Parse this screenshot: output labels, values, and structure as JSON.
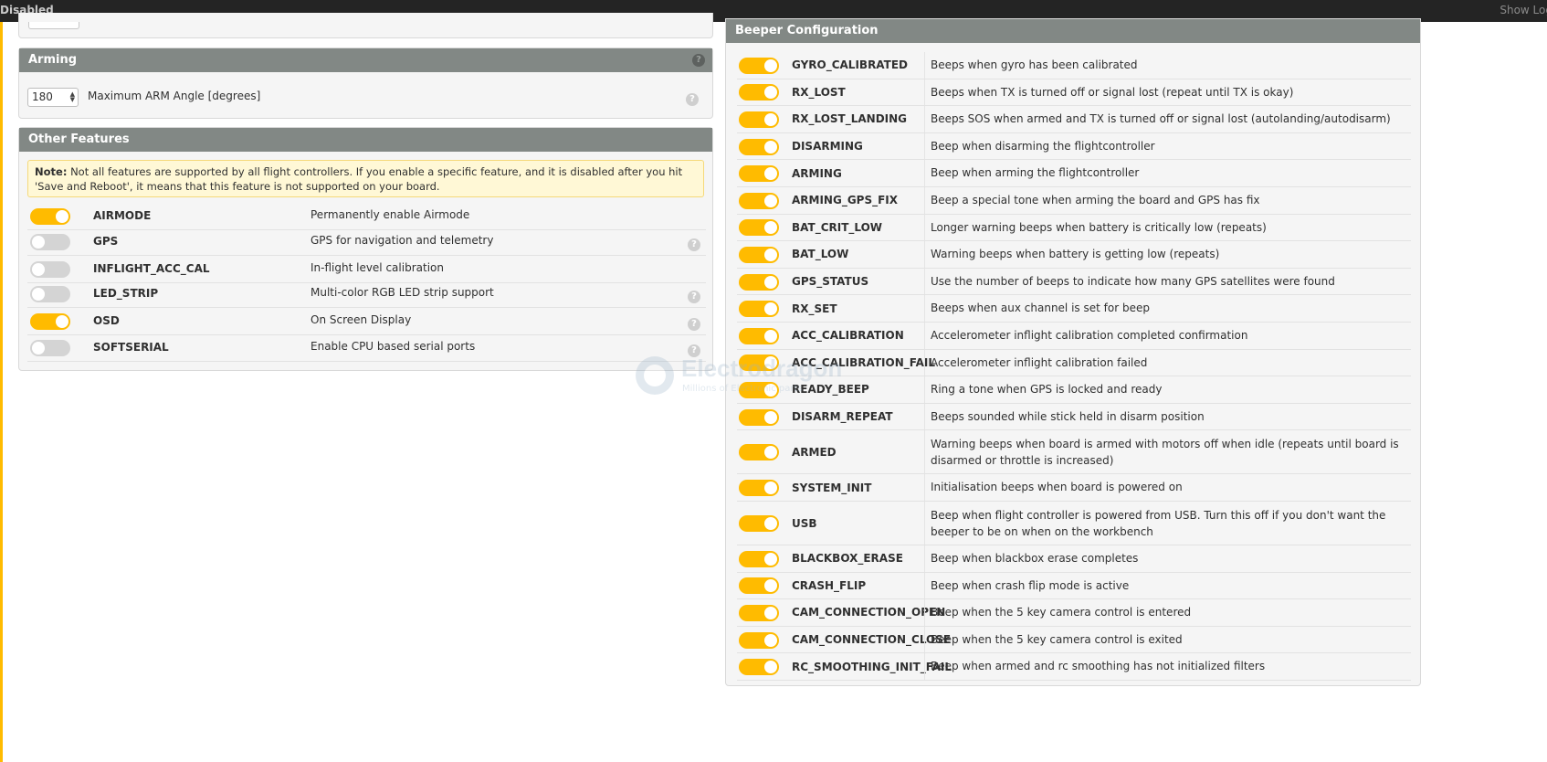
{
  "topbar": {
    "status": "Disabled",
    "show_log": "Show Log"
  },
  "arming": {
    "title": "Arming",
    "help": "?",
    "max_arm_angle_value": "180",
    "max_arm_angle_label": "Maximum ARM Angle [degrees]"
  },
  "other_features": {
    "title": "Other Features",
    "note_label": "Note:",
    "note_text": " Not all features are supported by all flight controllers. If you enable a specific feature, and it is disabled after you hit 'Save and Reboot', it means that this feature is not supported on your board.",
    "help": "?",
    "features": [
      {
        "name": "AIRMODE",
        "desc": "Permanently enable Airmode",
        "enabled": true,
        "help": false
      },
      {
        "name": "GPS",
        "desc": "GPS for navigation and telemetry",
        "enabled": false,
        "help": true
      },
      {
        "name": "INFLIGHT_ACC_CAL",
        "desc": "In-flight level calibration",
        "enabled": false,
        "help": false
      },
      {
        "name": "LED_STRIP",
        "desc": "Multi-color RGB LED strip support",
        "enabled": false,
        "help": true
      },
      {
        "name": "OSD",
        "desc": "On Screen Display",
        "enabled": true,
        "help": true
      },
      {
        "name": "SOFTSERIAL",
        "desc": "Enable CPU based serial ports",
        "enabled": false,
        "help": true
      }
    ]
  },
  "beeper": {
    "title": "Beeper Configuration",
    "items": [
      {
        "name": "GYRO_CALIBRATED",
        "desc": "Beeps when gyro has been calibrated",
        "enabled": true
      },
      {
        "name": "RX_LOST",
        "desc": "Beeps when TX is turned off or signal lost (repeat until TX is okay)",
        "enabled": true
      },
      {
        "name": "RX_LOST_LANDING",
        "desc": "Beeps SOS when armed and TX is turned off or signal lost (autolanding/autodisarm)",
        "enabled": true
      },
      {
        "name": "DISARMING",
        "desc": "Beep when disarming the flightcontroller",
        "enabled": true
      },
      {
        "name": "ARMING",
        "desc": "Beep when arming the flightcontroller",
        "enabled": true
      },
      {
        "name": "ARMING_GPS_FIX",
        "desc": "Beep a special tone when arming the board and GPS has fix",
        "enabled": true
      },
      {
        "name": "BAT_CRIT_LOW",
        "desc": "Longer warning beeps when battery is critically low (repeats)",
        "enabled": true
      },
      {
        "name": "BAT_LOW",
        "desc": "Warning beeps when battery is getting low (repeats)",
        "enabled": true
      },
      {
        "name": "GPS_STATUS",
        "desc": "Use the number of beeps to indicate how many GPS satellites were found",
        "enabled": true
      },
      {
        "name": "RX_SET",
        "desc": "Beeps when aux channel is set for beep",
        "enabled": true
      },
      {
        "name": "ACC_CALIBRATION",
        "desc": "Accelerometer inflight calibration completed confirmation",
        "enabled": true
      },
      {
        "name": "ACC_CALIBRATION_FAIL",
        "desc": "Accelerometer inflight calibration failed",
        "enabled": true
      },
      {
        "name": "READY_BEEP",
        "desc": "Ring a tone when GPS is locked and ready",
        "enabled": true
      },
      {
        "name": "DISARM_REPEAT",
        "desc": "Beeps sounded while stick held in disarm position",
        "enabled": true
      },
      {
        "name": "ARMED",
        "desc": "Warning beeps when board is armed with motors off when idle (repeats until board is disarmed or throttle is increased)",
        "enabled": true
      },
      {
        "name": "SYSTEM_INIT",
        "desc": "Initialisation beeps when board is powered on",
        "enabled": true
      },
      {
        "name": "USB",
        "desc": "Beep when flight controller is powered from USB. Turn this off if you don't want the beeper to be on when on the workbench",
        "enabled": true
      },
      {
        "name": "BLACKBOX_ERASE",
        "desc": "Beep when blackbox erase completes",
        "enabled": true
      },
      {
        "name": "CRASH_FLIP",
        "desc": "Beep when crash flip mode is active",
        "enabled": true
      },
      {
        "name": "CAM_CONNECTION_OPEN",
        "desc": "Beep when the 5 key camera control is entered",
        "enabled": true
      },
      {
        "name": "CAM_CONNECTION_CLOSE",
        "desc": "Beep when the 5 key camera control is exited",
        "enabled": true
      },
      {
        "name": "RC_SMOOTHING_INIT_FAIL",
        "desc": "Beep when armed and rc smoothing has not initialized filters",
        "enabled": true
      }
    ]
  },
  "watermark": {
    "title": "Electrodragon",
    "subtitle": "Millions of Electronic parts"
  },
  "colors": {
    "accent": "#ffbb00",
    "header": "#828885",
    "topbar": "#242424"
  }
}
